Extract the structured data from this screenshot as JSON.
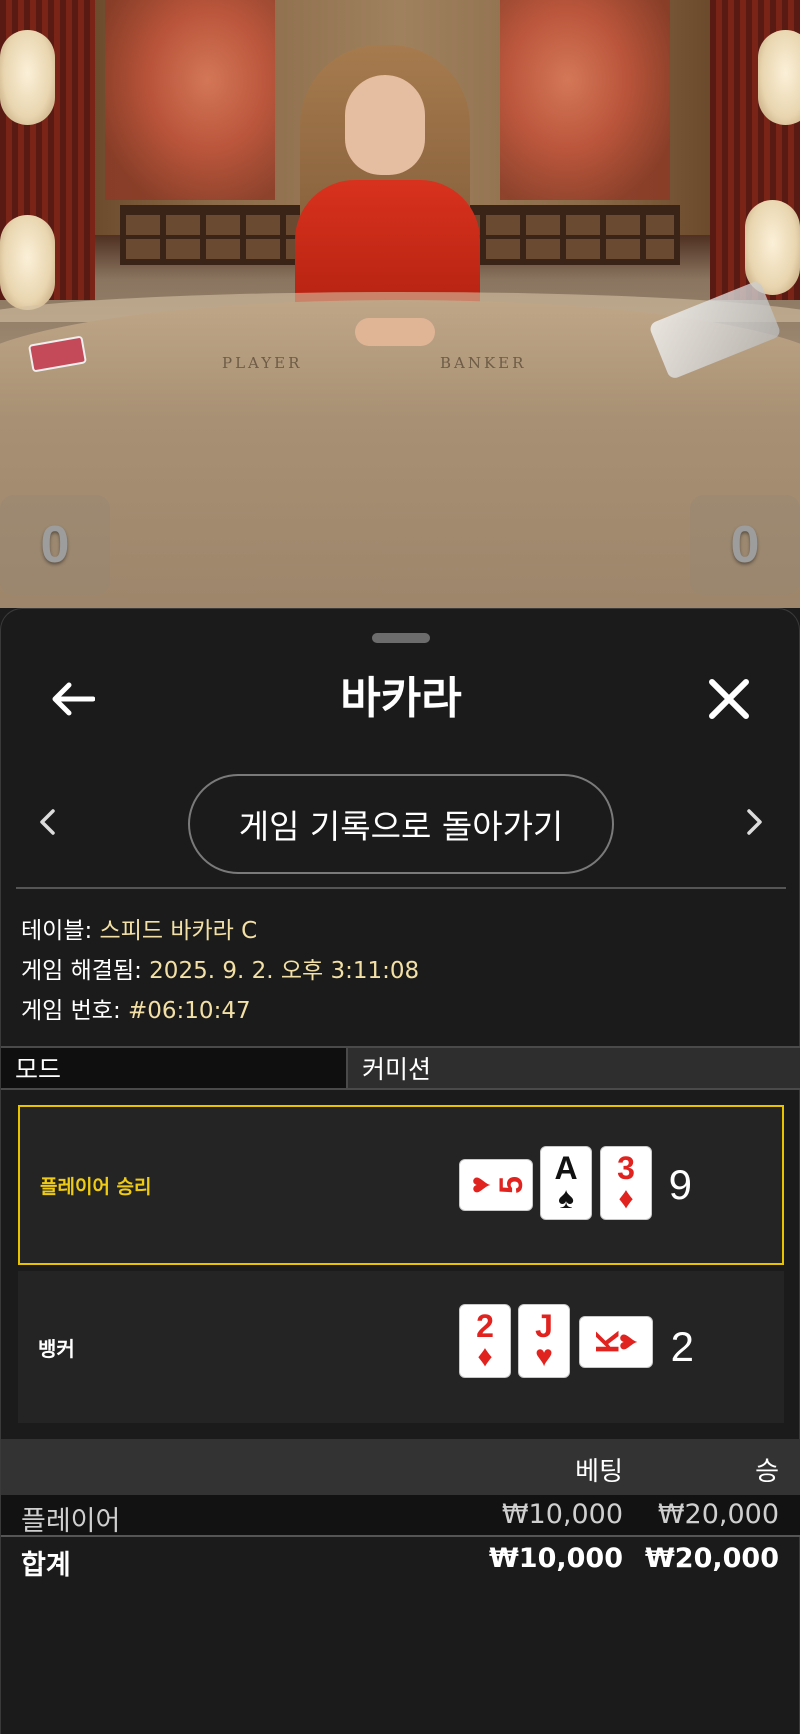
{
  "video": {
    "table_label_player": "PLAYER",
    "table_label_banker": "BANKER",
    "score_left": "0",
    "score_right": "0"
  },
  "header": {
    "title": "바카라",
    "back_icon": "arrow-left-icon",
    "close_icon": "close-icon"
  },
  "nav": {
    "prev_icon": "chevron-left-icon",
    "next_icon": "chevron-right-icon",
    "back_to_history_label": "게임 기록으로 돌아가기"
  },
  "info": {
    "table_label": "테이블: ",
    "table_value": "스피드 바카라 C",
    "resolved_label": "게임 해결됨: ",
    "resolved_value": "2025. 9. 2. 오후 3:11:08",
    "game_no_label": "게임 번호: ",
    "game_no_value": "#06:10:47"
  },
  "mode": {
    "left": "모드",
    "right": "커미션"
  },
  "hands": {
    "player": {
      "label": "플레이어 승리",
      "score": "9",
      "cards": [
        {
          "rank": "5",
          "suit": "♥",
          "color": "red",
          "orientation": "side"
        },
        {
          "rank": "A",
          "suit": "♠",
          "color": "black",
          "orientation": "upright"
        },
        {
          "rank": "3",
          "suit": "♦",
          "color": "red",
          "orientation": "upright"
        }
      ]
    },
    "banker": {
      "label": "뱅커",
      "score": "2",
      "cards": [
        {
          "rank": "2",
          "suit": "♦",
          "color": "red",
          "orientation": "upright"
        },
        {
          "rank": "J",
          "suit": "♥",
          "color": "red",
          "orientation": "upright"
        },
        {
          "rank": "K",
          "suit": "♥",
          "color": "red",
          "orientation": "side"
        }
      ]
    }
  },
  "bets": {
    "col_bet": "베팅",
    "col_win": "승",
    "rows": [
      {
        "name": "플레이어",
        "bet": "₩10,000",
        "win": "₩20,000"
      }
    ],
    "total": {
      "name": "합계",
      "bet": "₩10,000",
      "win": "₩20,000"
    }
  },
  "colors": {
    "win_highlight": "#e8c400",
    "info_value": "#f2e0a6",
    "card_red": "#e1231f"
  }
}
